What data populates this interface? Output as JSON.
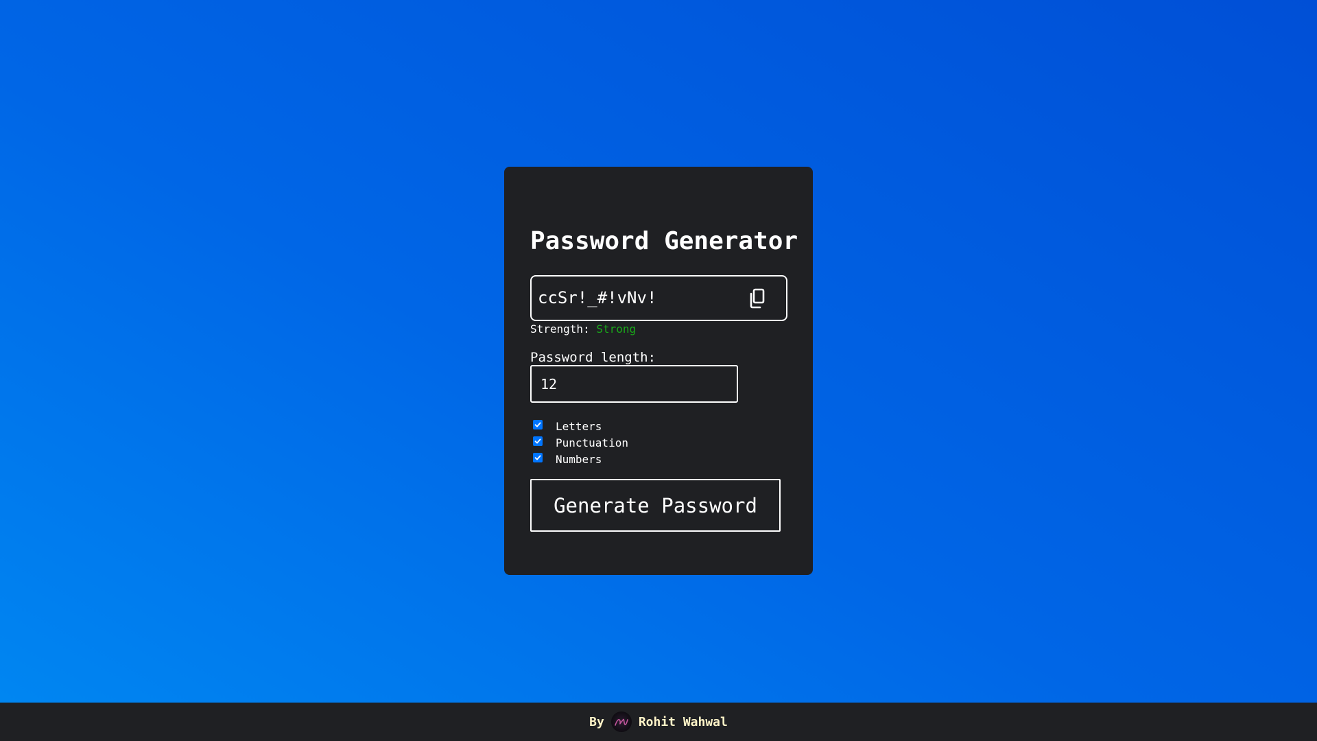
{
  "app": {
    "title": "Password Generator"
  },
  "password": {
    "value": "ccSr!_#!vNv!",
    "copy_icon": "copy-icon"
  },
  "strength": {
    "label": "Strength:",
    "value": "Strong",
    "color": "#1aa81a"
  },
  "length": {
    "label": "Password length:",
    "value": "12"
  },
  "options": [
    {
      "label": "Letters",
      "checked": true
    },
    {
      "label": "Punctuation",
      "checked": true
    },
    {
      "label": "Numbers",
      "checked": true
    }
  ],
  "generate_button": {
    "label": "Generate Password"
  },
  "footer": {
    "by": "By",
    "author": "Rohit Wahwal",
    "avatar_icon": "avatar-logo"
  },
  "colors": {
    "card_background": "#1f2023",
    "background_gradient_start": "#0088f2",
    "background_gradient_end": "#004fd6",
    "checkbox_accent": "#0075ff",
    "footer_text": "#fff4c8"
  }
}
